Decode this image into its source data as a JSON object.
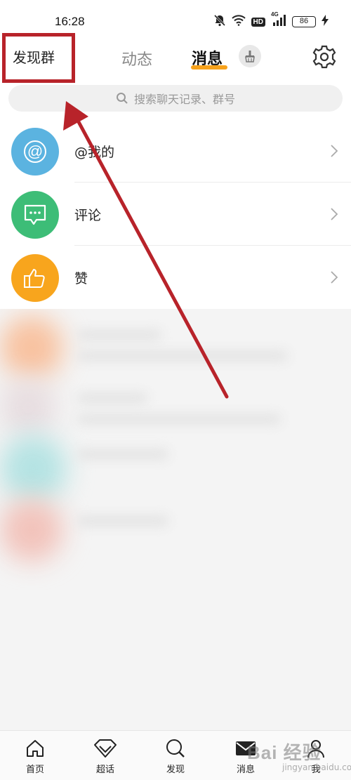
{
  "status_bar": {
    "time": "16:28",
    "hd_label": "HD",
    "network_label": "4G",
    "battery_level": "86"
  },
  "header": {
    "discover_group": "发现群",
    "tabs": [
      {
        "label": "动态",
        "active": false
      },
      {
        "label": "消息",
        "active": true
      }
    ],
    "accent_color": "#f7a21b"
  },
  "search": {
    "placeholder": "搜索聊天记录、群号"
  },
  "list": [
    {
      "label": "@我的",
      "icon": "at-icon",
      "color": "#5bb3e0"
    },
    {
      "label": "评论",
      "icon": "comment-icon",
      "color": "#3dbd77"
    },
    {
      "label": "赞",
      "icon": "thumbs-up-icon",
      "color": "#f8a51d"
    }
  ],
  "bottom_nav": [
    {
      "label": "首页",
      "icon": "home-icon"
    },
    {
      "label": "超话",
      "icon": "diamond-icon"
    },
    {
      "label": "发现",
      "icon": "search-icon"
    },
    {
      "label": "消息",
      "icon": "mail-icon"
    },
    {
      "label": "我",
      "icon": "user-icon"
    }
  ],
  "watermark": {
    "brand": "Bai 经验",
    "sub": "jingyan.baidu.com"
  },
  "annotation_color": "#b8232a"
}
